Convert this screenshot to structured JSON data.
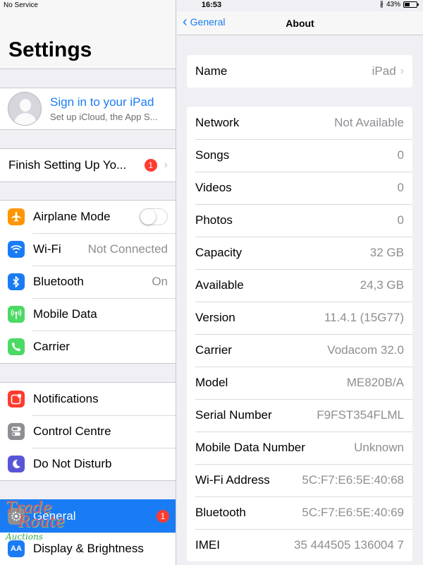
{
  "status": {
    "carrier": "No Service",
    "time": "16:53",
    "battery": "43%",
    "battery_level": 0.43
  },
  "left": {
    "title": "Settings",
    "profile": {
      "title": "Sign in to your iPad",
      "subtitle": "Set up iCloud, the App S..."
    },
    "finish": {
      "label": "Finish Setting Up Yo...",
      "badge": "1"
    },
    "groups": [
      [
        {
          "label": "Airplane Mode",
          "icon": "airplane-icon",
          "color": "#ff9500",
          "toggle": false
        },
        {
          "label": "Wi-Fi",
          "value": "Not Connected",
          "icon": "wifi-icon",
          "color": "#1a7cf4"
        },
        {
          "label": "Bluetooth",
          "value": "On",
          "icon": "bluetooth-icon",
          "color": "#1a7cf4"
        },
        {
          "label": "Mobile Data",
          "icon": "antenna-icon",
          "color": "#4cd964"
        },
        {
          "label": "Carrier",
          "icon": "phone-icon",
          "color": "#4cd964"
        }
      ],
      [
        {
          "label": "Notifications",
          "icon": "notifications-icon",
          "color": "#ff3b30"
        },
        {
          "label": "Control Centre",
          "icon": "switches-icon",
          "color": "#8e8e93"
        },
        {
          "label": "Do Not Disturb",
          "icon": "moon-icon",
          "color": "#5856d6"
        }
      ],
      [
        {
          "label": "General",
          "icon": "gear-icon",
          "color": "#8e8e93",
          "badge": "1",
          "selected": true
        },
        {
          "label": "Display & Brightness",
          "icon": "display-icon",
          "color": "#1a7cf4"
        }
      ]
    ],
    "watermark": {
      "line1": "Trade",
      "line2": "Route",
      "line3": "Auctions"
    }
  },
  "nav": {
    "back": "General",
    "title": "About"
  },
  "about": {
    "name": {
      "label": "Name",
      "value": "iPad"
    },
    "rows": [
      {
        "label": "Network",
        "value": "Not Available"
      },
      {
        "label": "Songs",
        "value": "0"
      },
      {
        "label": "Videos",
        "value": "0"
      },
      {
        "label": "Photos",
        "value": "0"
      },
      {
        "label": "Capacity",
        "value": "32 GB"
      },
      {
        "label": "Available",
        "value": "24,3 GB"
      },
      {
        "label": "Version",
        "value": "11.4.1 (15G77)"
      },
      {
        "label": "Carrier",
        "value": "Vodacom 32.0"
      },
      {
        "label": "Model",
        "value": "ME820B/A"
      },
      {
        "label": "Serial Number",
        "value": "F9FST354FLML"
      },
      {
        "label": "Mobile Data Number",
        "value": "Unknown"
      },
      {
        "label": "Wi-Fi Address",
        "value": "5C:F7:E6:5E:40:68"
      },
      {
        "label": "Bluetooth",
        "value": "5C:F7:E6:5E:40:69"
      },
      {
        "label": "IMEI",
        "value": "35 444505 136004 7"
      }
    ]
  }
}
